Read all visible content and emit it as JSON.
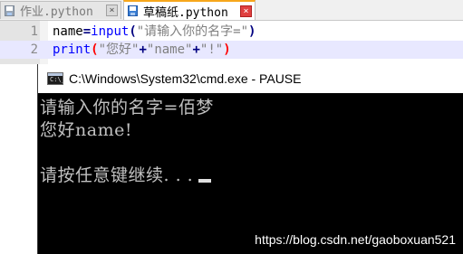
{
  "tabs": [
    {
      "label": "作业.python",
      "close": "×",
      "active": false
    },
    {
      "label": "草稿纸.python",
      "close": "×",
      "active": true
    }
  ],
  "editor": {
    "line_numbers": [
      "1",
      "2"
    ],
    "line1": {
      "var": "name",
      "eq": "=",
      "func": "input",
      "open": "(",
      "str": "\"请输入你的名字=\"",
      "close": ")"
    },
    "line2": {
      "func": "print",
      "open": "(",
      "s1": "\"您好\"",
      "p1": "+",
      "s2": "\"name\"",
      "p2": "+",
      "s3": "\"!\"",
      "close": ")"
    }
  },
  "cmd": {
    "title": "C:\\Windows\\System32\\cmd.exe - PAUSE",
    "icon_text": "C:\\_",
    "lines": [
      "请输入你的名字=佰梦",
      "您好name!",
      "",
      "请按任意键继续. . ."
    ]
  },
  "watermark": "https://blog.csdn.net/gaoboxuan521",
  "colors": {
    "active_tab_accent": "#f7a71c",
    "keyword": "#0000ff",
    "string": "#808080",
    "paren": "#ff0000",
    "console_bg": "#000000",
    "console_text": "#c0c0c0"
  }
}
